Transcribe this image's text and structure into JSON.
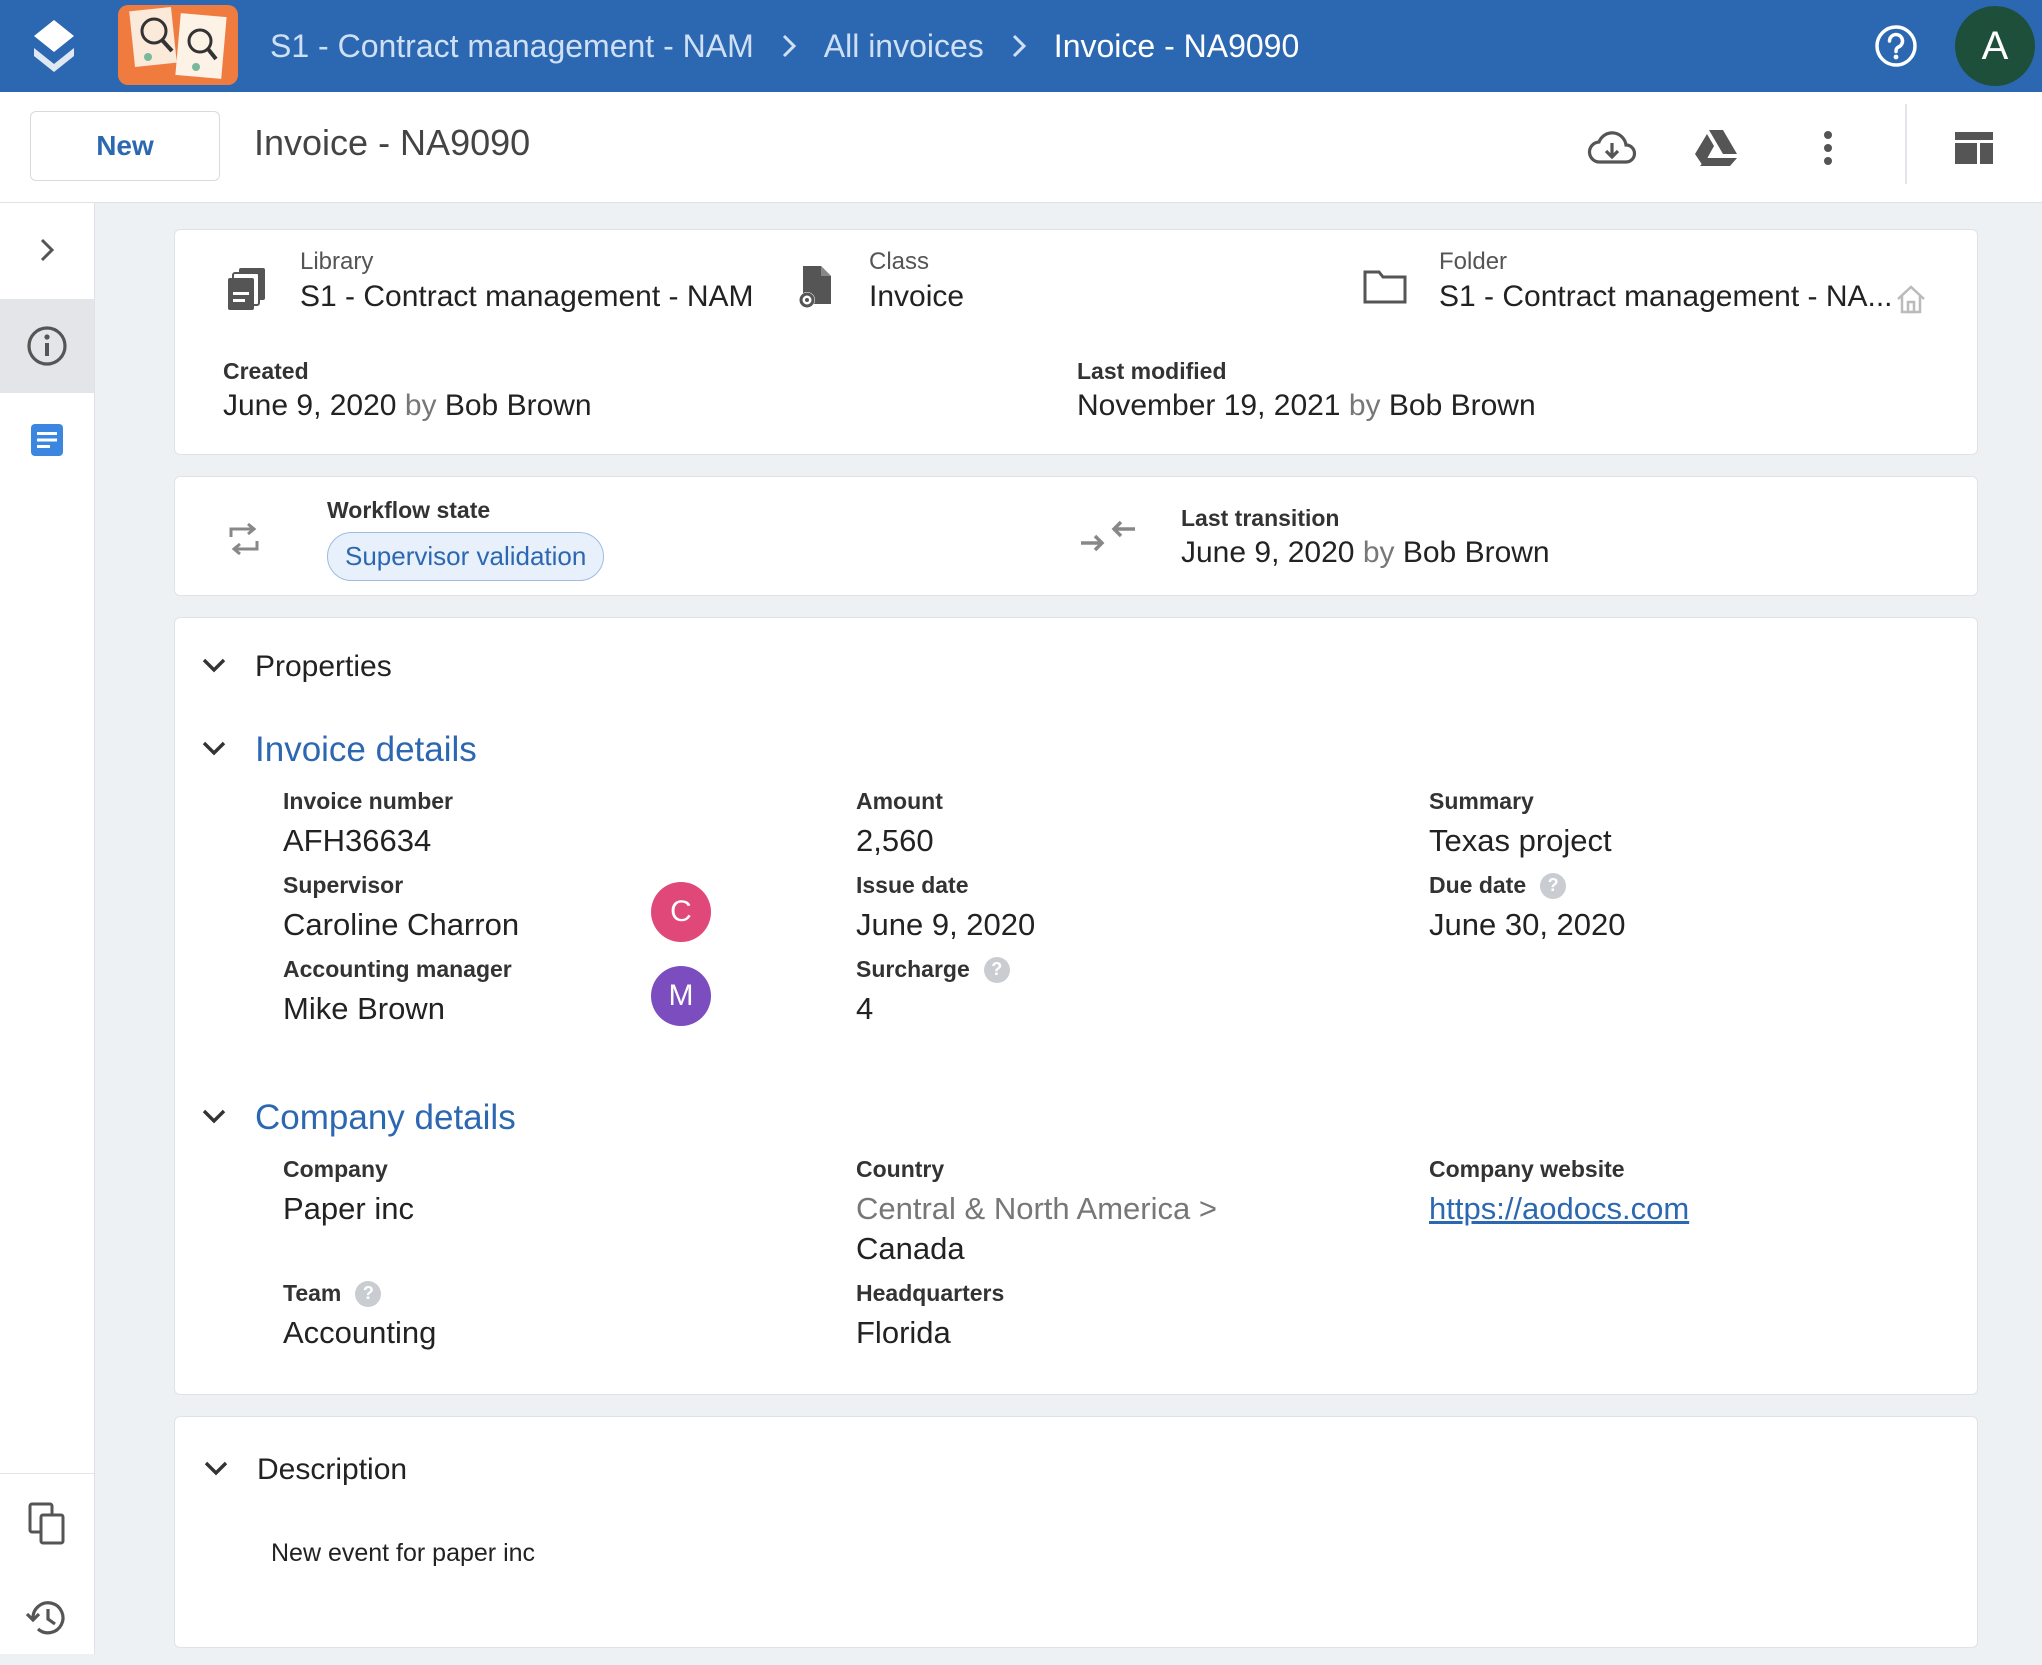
{
  "header": {
    "breadcrumbs": [
      "S1 - Contract management - NAM",
      "All invoices",
      "Invoice - NA9090"
    ],
    "avatar_letter": "A"
  },
  "toolbar": {
    "new_label": "New",
    "title": "Invoice - NA9090"
  },
  "meta": {
    "library_label": "Library",
    "library_value": "S1 - Contract management - NAM",
    "class_label": "Class",
    "class_value": "Invoice",
    "folder_label": "Folder",
    "folder_value": "S1 - Contract management - NA...",
    "created_label": "Created",
    "created_date": "June 9, 2020",
    "created_by_word": "by",
    "created_by": "Bob Brown",
    "modified_label": "Last modified",
    "modified_date": "November 19, 2021",
    "modified_by_word": "by",
    "modified_by": "Bob Brown"
  },
  "workflow": {
    "state_label": "Workflow state",
    "state_value": "Supervisor validation",
    "transition_label": "Last transition",
    "transition_date": "June 9, 2020",
    "transition_by_word": "by",
    "transition_by": "Bob Brown"
  },
  "properties": {
    "title": "Properties",
    "invoice_section": {
      "title": "Invoice details",
      "invoice_number_label": "Invoice number",
      "invoice_number": "AFH36634",
      "amount_label": "Amount",
      "amount": "2,560",
      "summary_label": "Summary",
      "summary": "Texas project",
      "supervisor_label": "Supervisor",
      "supervisor": "Caroline Charron",
      "supervisor_initial": "C",
      "issue_date_label": "Issue date",
      "issue_date": "June 9, 2020",
      "due_date_label": "Due date",
      "due_date": "June 30, 2020",
      "accounting_manager_label": "Accounting manager",
      "accounting_manager": "Mike Brown",
      "accounting_manager_initial": "M",
      "surcharge_label": "Surcharge",
      "surcharge": "4"
    },
    "company_section": {
      "title": "Company details",
      "company_label": "Company",
      "company": "Paper inc",
      "country_label": "Country",
      "country_path": "Central & North America >",
      "country": "Canada",
      "website_label": "Company website",
      "website": "https://aodocs.com",
      "team_label": "Team",
      "team": "Accounting",
      "hq_label": "Headquarters",
      "hq": "Florida"
    }
  },
  "description": {
    "title": "Description",
    "text": "New event for paper inc"
  },
  "colors": {
    "brand_blue": "#2c68b1",
    "supervisor_avatar": "#e0487a",
    "manager_avatar": "#7c4dbf",
    "top_avatar": "#1d4f3b"
  }
}
